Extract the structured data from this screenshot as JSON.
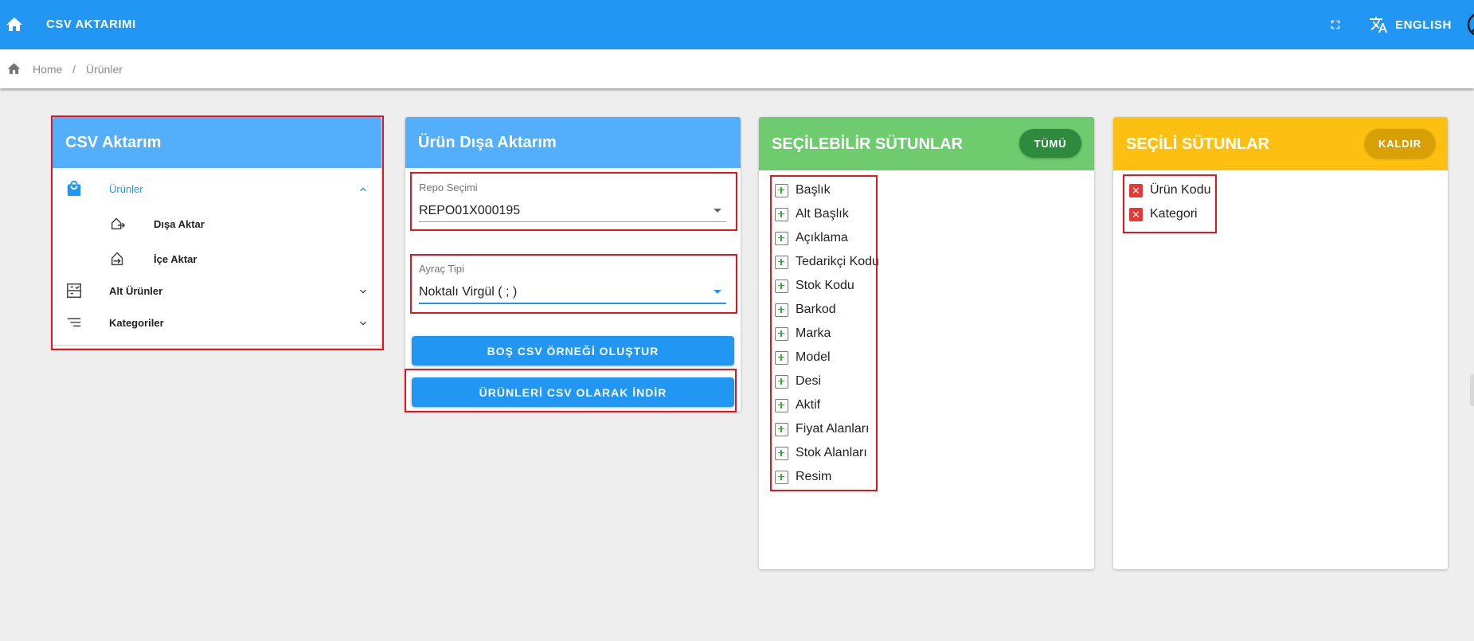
{
  "topbar": {
    "title": "CSV AKTARIMI",
    "language": "ENGLISH"
  },
  "breadcrumb": {
    "home": "Home",
    "separator": "/",
    "current": "Ürünler"
  },
  "nav_card": {
    "title": "CSV Aktarım",
    "items": [
      {
        "label": "Ürünler",
        "icon": "shopping-bag-icon",
        "expanded": true
      },
      {
        "label": "Dışa Aktar",
        "icon": "export-icon"
      },
      {
        "label": "İçe Aktar",
        "icon": "import-icon"
      },
      {
        "label": "Alt Ürünler",
        "icon": "sub-products-icon",
        "expanded": false
      },
      {
        "label": "Kategoriler",
        "icon": "categories-icon",
        "expanded": false
      }
    ]
  },
  "export_card": {
    "title": "Ürün Dışa Aktarım",
    "repo": {
      "label": "Repo Seçimi",
      "value": "REPO01X000195"
    },
    "separator": {
      "label": "Ayraç Tipi",
      "value": "Noktalı Virgül ( ; )"
    },
    "btn_empty_csv": "BOŞ CSV ÖRNEĞİ OLUŞTUR",
    "btn_download": "ÜRÜNLERİ CSV OLARAK İNDİR"
  },
  "selectable_card": {
    "title": "SEÇİLEBİLİR SÜTUNLAR",
    "all_button": "TÜMÜ",
    "columns": [
      "Başlık",
      "Alt Başlık",
      "Açıklama",
      "Tedarikçi Kodu",
      "Stok Kodu",
      "Barkod",
      "Marka",
      "Model",
      "Desi",
      "Aktif",
      "Fiyat Alanları",
      "Stok Alanları",
      "Resim"
    ]
  },
  "selected_card": {
    "title": "SEÇİLİ SÜTUNLAR",
    "remove_button": "KALDIR",
    "columns": [
      "Ürün Kodu",
      "Kategori"
    ]
  },
  "colors": {
    "primary": "#2196f3",
    "nav_header": "#53aefc",
    "green_header": "#6ecb6e",
    "yellow_header": "#fdc010",
    "red_box": "#e8131b"
  }
}
